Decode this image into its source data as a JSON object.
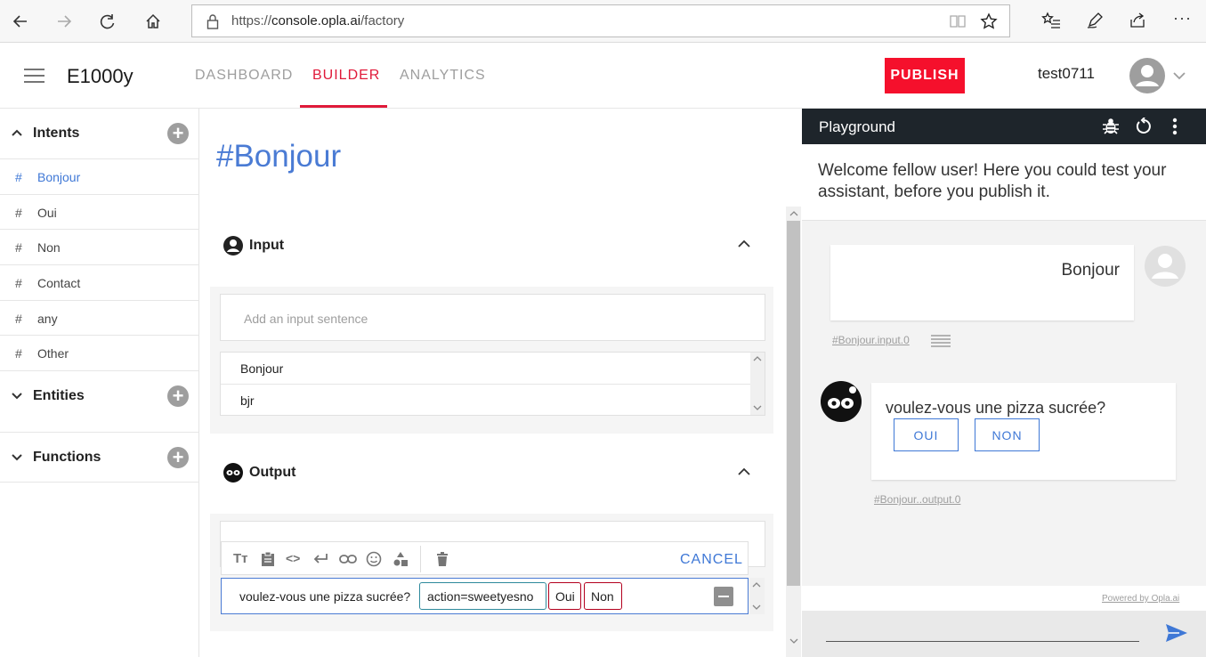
{
  "browser": {
    "url_scheme": "https://",
    "url_host": "console.opla.ai",
    "url_path": "/factory"
  },
  "header": {
    "app_title": "E1000y",
    "tabs": [
      {
        "label": "DASHBOARD",
        "active": false
      },
      {
        "label": "BUILDER",
        "active": true
      },
      {
        "label": "ANALYTICS",
        "active": false
      }
    ],
    "publish_label": "PUBLISH",
    "username": "test0711"
  },
  "sidebar": {
    "intents_title": "Intents",
    "intents": [
      {
        "label": "Bonjour",
        "active": true
      },
      {
        "label": "Oui",
        "active": false
      },
      {
        "label": "Non",
        "active": false
      },
      {
        "label": "Contact",
        "active": false
      },
      {
        "label": "any",
        "active": false
      },
      {
        "label": "Other",
        "active": false
      }
    ],
    "entities_title": "Entities",
    "functions_title": "Functions"
  },
  "editor": {
    "intent_title": "#Bonjour",
    "input_title": "Input",
    "input_placeholder": "Add an input sentence",
    "input_sentences": [
      "Bonjour",
      "bjr"
    ],
    "output_title": "Output",
    "cancel_label": "CANCEL",
    "output_text": "voulez-vous une pizza sucrée?",
    "output_action": "action=sweetyesno",
    "output_button_1": "Oui",
    "output_button_2": "Non"
  },
  "playground": {
    "title": "Playground",
    "welcome": "Welcome fellow user! Here you could test your assistant, before you publish it.",
    "user_message": "Bonjour",
    "user_ref": "#Bonjour.input.0",
    "bot_message": "voulez-vous une pizza sucrée?",
    "bot_choice_1": "OUI",
    "bot_choice_2": "NON",
    "bot_ref": "#Bonjour..output.0",
    "powered_by": "Powered by Opla.ai"
  },
  "colors": {
    "accent_red": "#e01a3a",
    "publish_red": "#f5102c",
    "link_blue": "#3f78d6",
    "playground_header": "#1e252b"
  }
}
